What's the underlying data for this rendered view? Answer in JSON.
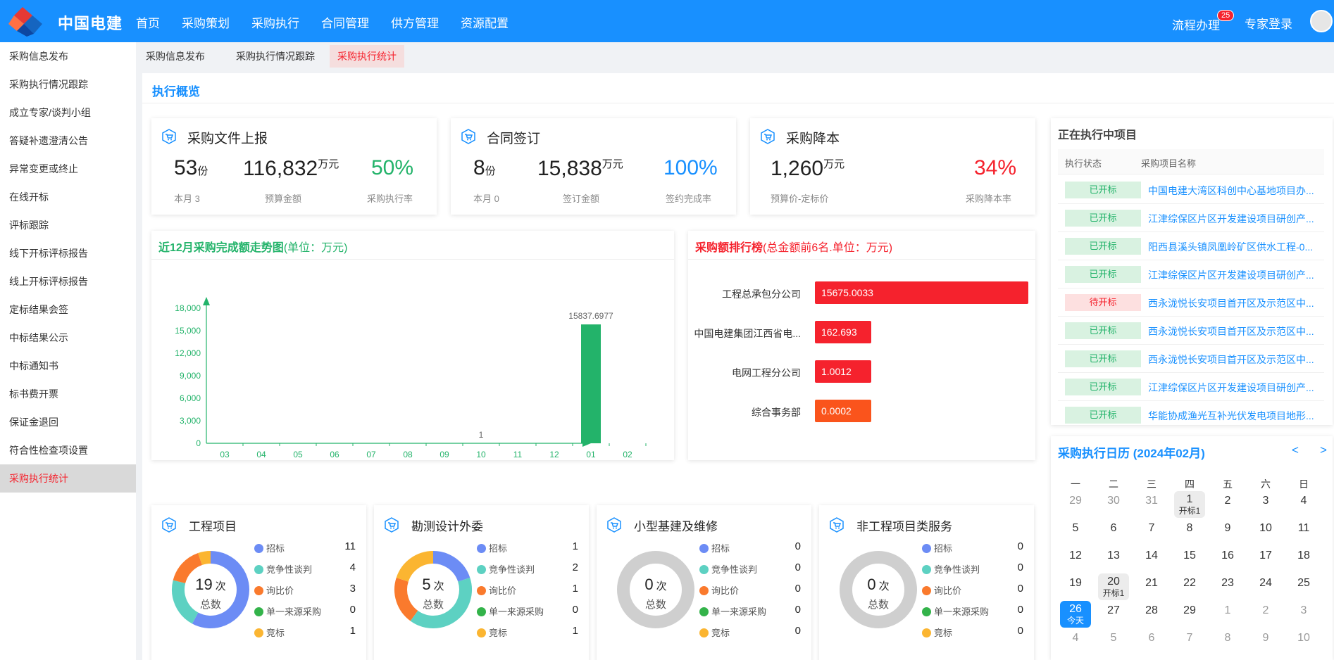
{
  "app": {
    "brand": "中国电建"
  },
  "nav": [
    "首页",
    "采购策划",
    "采购执行",
    "合同管理",
    "供方管理",
    "资源配置"
  ],
  "header_right": {
    "flow_label": "流程办理",
    "flow_badge": "25",
    "expert_label": "专家登录"
  },
  "sidebar": [
    "采购信息发布",
    "采购执行情况跟踪",
    "成立专家/谈判小组",
    "答疑补遗澄清公告",
    "异常变更或终止",
    "在线开标",
    "评标跟踪",
    "线下开标评标报告",
    "线上开标评标报告",
    "定标结果会签",
    "中标结果公示",
    "中标通知书",
    "标书费开票",
    "保证金退回",
    "符合性检查项设置",
    "采购执行统计"
  ],
  "sidebar_active": "采购执行统计",
  "tabs": [
    "采购信息发布",
    "采购执行情况跟踪",
    "采购执行统计"
  ],
  "tab_active": "采购执行统计",
  "overview_title": "执行概览",
  "stats": [
    {
      "title": "采购文件上报",
      "count": "53",
      "count_unit": "份",
      "count_sub": "本月 3",
      "amount": "116,832",
      "amount_unit": "万元",
      "amount_sub": "预算金额",
      "rate": "50%",
      "rate_sub": "采购执行率",
      "rate_color": "#23b36a"
    },
    {
      "title": "合同签订",
      "count": "8",
      "count_unit": "份",
      "count_sub": "本月 0",
      "amount": "15,838",
      "amount_unit": "万元",
      "amount_sub": "签订金额",
      "rate": "100%",
      "rate_sub": "签约完成率",
      "rate_color": "#1890ff"
    },
    {
      "title": "采购降本",
      "amount": "1,260",
      "amount_unit": "万元",
      "amount_sub": "预算价-定标价",
      "rate": "34%",
      "rate_sub": "采购降本率",
      "rate_color": "#f5222d"
    }
  ],
  "trend": {
    "title": "近12月采购完成额走势图",
    "unit": "(单位：万元)"
  },
  "ranking": {
    "title": "采购额排行榜",
    "unit": "(总金额前6名.单位：万元)"
  },
  "chart_data": [
    {
      "type": "bar",
      "title": "近12月采购完成额走势图(单位：万元)",
      "categories": [
        "03",
        "04",
        "05",
        "06",
        "07",
        "08",
        "09",
        "10",
        "11",
        "12",
        "01",
        "02"
      ],
      "values": [
        0,
        0,
        0,
        0,
        0,
        0,
        0,
        1,
        0,
        0,
        15837.6977,
        0
      ],
      "data_labels": {
        "10": "1",
        "01": "15837.6977"
      },
      "yticks": [
        "0",
        "3,000",
        "6,000",
        "9,000",
        "12,000",
        "15,000",
        "18,000"
      ],
      "ylim": [
        0,
        18000
      ],
      "color": "#23b36a"
    },
    {
      "type": "bar",
      "orientation": "horizontal",
      "title": "采购额排行榜(总金额前6名.单位：万元)",
      "categories": [
        "工程总承包分公司",
        "中国电建集团江西省电...",
        "电网工程分公司",
        "综合事务部"
      ],
      "values": [
        15675.0033,
        162.693,
        1.0012,
        0.0002
      ],
      "labels": [
        "15675.0033",
        "162.693",
        "1.0012",
        "0.0002"
      ],
      "colors": [
        "#f5222d",
        "#f5222d",
        "#f5222d",
        "#fa541c"
      ]
    },
    {
      "type": "pie",
      "title": "工程项目",
      "total": "19",
      "total_unit": "次",
      "total_label": "总数",
      "categories": [
        "招标",
        "竞争性谈判",
        "询比价",
        "单一来源采购",
        "竞标"
      ],
      "values": [
        11,
        4,
        3,
        0,
        1
      ]
    },
    {
      "type": "pie",
      "title": "勘测设计外委",
      "total": "5",
      "total_unit": "次",
      "total_label": "总数",
      "categories": [
        "招标",
        "竞争性谈判",
        "询比价",
        "单一来源采购",
        "竞标"
      ],
      "values": [
        1,
        2,
        1,
        0,
        1
      ]
    },
    {
      "type": "pie",
      "title": "小型基建及维修",
      "total": "0",
      "total_unit": "次",
      "total_label": "总数",
      "categories": [
        "招标",
        "竞争性谈判",
        "询比价",
        "单一来源采购",
        "竞标"
      ],
      "values": [
        0,
        0,
        0,
        0,
        0
      ]
    },
    {
      "type": "pie",
      "title": "非工程项目类服务",
      "total": "0",
      "total_unit": "次",
      "total_label": "总数",
      "categories": [
        "招标",
        "竞争性谈判",
        "询比价",
        "单一来源采购",
        "竞标"
      ],
      "values": [
        0,
        0,
        0,
        0,
        0
      ]
    }
  ],
  "pie_colors": [
    "#6c8cf5",
    "#5dd1c2",
    "#fa7a2d",
    "#33b34a",
    "#fbb531"
  ],
  "projects": {
    "title": "正在执行中项目",
    "headers": [
      "执行状态",
      "采购项目名称"
    ],
    "rows": [
      {
        "status": "已开标",
        "state": "done",
        "name": "中国电建大湾区科创中心基地项目办..."
      },
      {
        "status": "已开标",
        "state": "done",
        "name": "江津综保区片区开发建设项目研创产..."
      },
      {
        "status": "已开标",
        "state": "done",
        "name": "阳西县溪头镇凤凰岭矿区供水工程-0..."
      },
      {
        "status": "已开标",
        "state": "done",
        "name": "江津综保区片区开发建设项目研创产..."
      },
      {
        "status": "待开标",
        "state": "wait",
        "name": "西永泷悦长安项目首开区及示范区中..."
      },
      {
        "status": "已开标",
        "state": "done",
        "name": "西永泷悦长安项目首开区及示范区中..."
      },
      {
        "status": "已开标",
        "state": "done",
        "name": "西永泷悦长安项目首开区及示范区中..."
      },
      {
        "status": "已开标",
        "state": "done",
        "name": "江津综保区片区开发建设项目研创产..."
      },
      {
        "status": "已开标",
        "state": "done",
        "name": "华能协成渔光互补光伏发电项目地形..."
      }
    ]
  },
  "calendar": {
    "title": "采购执行日历 (2024年02月)",
    "prev": "<",
    "next": ">",
    "weekdays": [
      "一",
      "二",
      "三",
      "四",
      "五",
      "六",
      "日"
    ],
    "weeks": [
      [
        {
          "d": "29",
          "o": 1
        },
        {
          "d": "30",
          "o": 1
        },
        {
          "d": "31",
          "o": 1
        },
        {
          "d": "1",
          "note": "开标1"
        },
        {
          "d": "2"
        },
        {
          "d": "3"
        },
        {
          "d": "4"
        }
      ],
      [
        {
          "d": "5"
        },
        {
          "d": "6"
        },
        {
          "d": "7"
        },
        {
          "d": "8"
        },
        {
          "d": "9"
        },
        {
          "d": "10"
        },
        {
          "d": "11"
        }
      ],
      [
        {
          "d": "12"
        },
        {
          "d": "13"
        },
        {
          "d": "14"
        },
        {
          "d": "15"
        },
        {
          "d": "16"
        },
        {
          "d": "17"
        },
        {
          "d": "18"
        }
      ],
      [
        {
          "d": "19"
        },
        {
          "d": "20",
          "note": "开标1"
        },
        {
          "d": "21"
        },
        {
          "d": "22"
        },
        {
          "d": "23"
        },
        {
          "d": "24"
        },
        {
          "d": "25"
        }
      ],
      [
        {
          "d": "26",
          "note": "今天",
          "today": 1
        },
        {
          "d": "27"
        },
        {
          "d": "28"
        },
        {
          "d": "29"
        },
        {
          "d": "1",
          "o": 1
        },
        {
          "d": "2",
          "o": 1
        },
        {
          "d": "3",
          "o": 1
        }
      ],
      [
        {
          "d": "4",
          "o": 1
        },
        {
          "d": "5",
          "o": 1
        },
        {
          "d": "6",
          "o": 1
        },
        {
          "d": "7",
          "o": 1
        },
        {
          "d": "8",
          "o": 1
        },
        {
          "d": "9",
          "o": 1
        },
        {
          "d": "10",
          "o": 1
        }
      ]
    ]
  }
}
